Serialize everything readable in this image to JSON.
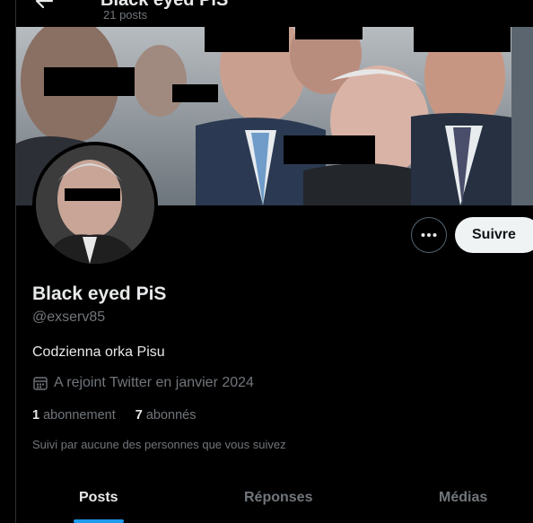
{
  "header": {
    "name_clipped": "Black eyed PiS",
    "post_count": "21 posts"
  },
  "profile": {
    "display_name": "Black eyed PiS",
    "handle": "@exserv85",
    "bio": "Codzienna orka Pisu",
    "joined": "A rejoint Twitter en janvier 2024",
    "following_count": "1",
    "following_label": "abonnement",
    "followers_count": "7",
    "followers_label": "abonnés",
    "followed_by": "Suivi par aucune des personnes que vous suivez"
  },
  "actions": {
    "follow_label": "Suivre"
  },
  "tabs": [
    {
      "label": "Posts",
      "active": true
    },
    {
      "label": "Réponses",
      "active": false
    },
    {
      "label": "Médias",
      "active": false
    }
  ],
  "colors": {
    "accent": "#1d9bf0",
    "background": "#000000",
    "text_primary": "#e7e9ea",
    "text_secondary": "#71767b"
  },
  "icons": [
    "back-arrow-icon",
    "more-options-icon",
    "calendar-icon"
  ]
}
